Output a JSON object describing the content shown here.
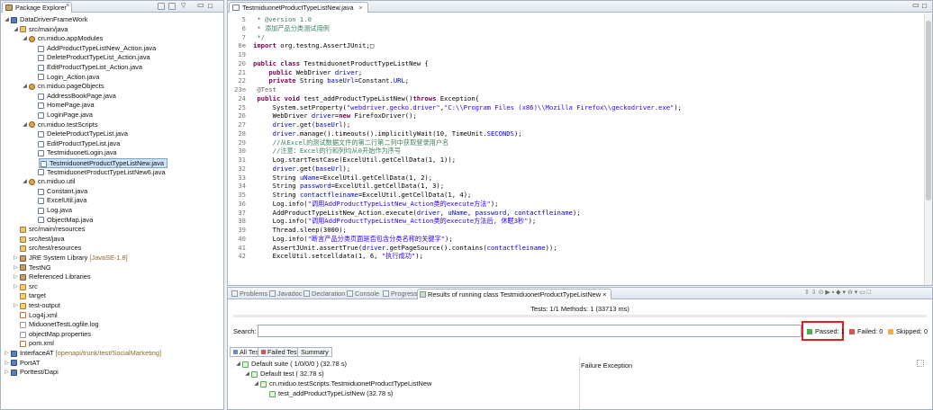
{
  "package_explorer": {
    "title": "Package Explorer",
    "tree": [
      {
        "label": "DataDrivenFrameWork",
        "level": 0,
        "icon": "project-icon",
        "expanded": true
      },
      {
        "label": "src/main/java",
        "level": 1,
        "icon": "source-folder-icon",
        "expanded": true
      },
      {
        "label": "cn.miduo.appModules",
        "level": 2,
        "icon": "package-icon",
        "expanded": true
      },
      {
        "label": "AddProductTypeListNew_Action.java",
        "level": 3,
        "icon": "java-file-icon"
      },
      {
        "label": "DeleteProductTypeList_Action.java",
        "level": 3,
        "icon": "java-file-icon"
      },
      {
        "label": "EditProductTypeList_Action.java",
        "level": 3,
        "icon": "java-file-icon"
      },
      {
        "label": "Login_Action.java",
        "level": 3,
        "icon": "java-file-icon"
      },
      {
        "label": "cn.miduo.pageObjects",
        "level": 2,
        "icon": "package-icon",
        "expanded": true
      },
      {
        "label": "AddressBookPage.java",
        "level": 3,
        "icon": "java-file-icon"
      },
      {
        "label": "HomePage.java",
        "level": 3,
        "icon": "java-file-icon"
      },
      {
        "label": "LoginPage.java",
        "level": 3,
        "icon": "java-file-icon"
      },
      {
        "label": "cn.miduo.testScripts",
        "level": 2,
        "icon": "package-icon",
        "expanded": true
      },
      {
        "label": "DeleteProductTypeList.java",
        "level": 3,
        "icon": "java-file-icon"
      },
      {
        "label": "EditProductTypeList.java",
        "level": 3,
        "icon": "java-file-icon"
      },
      {
        "label": "TestmiduonetLogin.java",
        "level": 3,
        "icon": "java-file-icon"
      },
      {
        "label": "TestmiduonetProductTypeListNew.java",
        "level": 3,
        "icon": "java-file-icon",
        "selected": true
      },
      {
        "label": "TestmiduonetProductTypeListNew6.java",
        "level": 3,
        "icon": "java-file-icon"
      },
      {
        "label": "cn.miduo.util",
        "level": 2,
        "icon": "package-icon",
        "expanded": true
      },
      {
        "label": "Constant.java",
        "level": 3,
        "icon": "java-file-icon"
      },
      {
        "label": "ExcelUtil.java",
        "level": 3,
        "icon": "java-file-icon"
      },
      {
        "label": "Log.java",
        "level": 3,
        "icon": "java-file-icon"
      },
      {
        "label": "ObjectMap.java",
        "level": 3,
        "icon": "java-file-icon"
      },
      {
        "label": "src/main/resources",
        "level": 1,
        "icon": "source-folder-icon"
      },
      {
        "label": "src/test/java",
        "level": 1,
        "icon": "source-folder-icon"
      },
      {
        "label": "src/test/resources",
        "level": 1,
        "icon": "source-folder-icon"
      },
      {
        "label": "JRE System Library",
        "suffix": "[JavaSE-1.8]",
        "level": 1,
        "icon": "library-icon",
        "collapsed": true
      },
      {
        "label": "TestNG",
        "level": 1,
        "icon": "library-icon",
        "collapsed": true
      },
      {
        "label": "Referenced Libraries",
        "level": 1,
        "icon": "library-icon",
        "collapsed": true
      },
      {
        "label": "src",
        "level": 1,
        "icon": "folder-icon",
        "collapsed": true
      },
      {
        "label": "target",
        "level": 1,
        "icon": "folder-icon"
      },
      {
        "label": "test-output",
        "level": 1,
        "icon": "folder-icon",
        "collapsed": true
      },
      {
        "label": "Log4j.xml",
        "level": 1,
        "icon": "xml-file-icon"
      },
      {
        "label": "MiduonetTestLogfile.log",
        "level": 1,
        "icon": "file-icon"
      },
      {
        "label": "objectMap.properties",
        "level": 1,
        "icon": "file-icon"
      },
      {
        "label": "pom.xml",
        "level": 1,
        "icon": "xml-file-icon"
      },
      {
        "label": "InterfaceAT",
        "suffix": "[openapi/trunk/test/SocialMarketing]",
        "level": 0,
        "icon": "project-icon",
        "collapsed": true
      },
      {
        "label": "PortAT",
        "level": 0,
        "icon": "project-icon",
        "collapsed": true
      },
      {
        "label": "Porttest/Dapi",
        "level": 0,
        "icon": "project-icon",
        "collapsed": true
      }
    ]
  },
  "editor": {
    "tab_title": "TestmiduonetProductTypeListNew.java",
    "lines": [
      {
        "n": "5",
        "t": " * @version 1.0",
        "c": "comment"
      },
      {
        "n": "6",
        "t": " * 添加产品分类测试用例",
        "c": "comment"
      },
      {
        "n": "7",
        "t": " */",
        "c": "comment"
      },
      {
        "n": "8⊕",
        "t": "import org.testng.AssertJUnit;□",
        "c": "import"
      },
      {
        "n": "19",
        "t": "",
        "c": "plain"
      },
      {
        "n": "20",
        "t": "public class TestmiduonetProductTypeListNew {",
        "c": "plain"
      },
      {
        "n": "21",
        "t": "    public WebDriver driver;",
        "c": "plain"
      },
      {
        "n": "22",
        "t": "    private String baseUrl=Constant.URL;",
        "c": "plain"
      },
      {
        "n": "23⊖",
        "t": " @Test",
        "c": "annotation"
      },
      {
        "n": "24",
        "t": " public void test_addProductTypeListNew()throws Exception{",
        "c": "plain"
      },
      {
        "n": "25",
        "t": "     System.setProperty(\"webdriver.gecko.driver\",\"C:\\\\Program Files (x86)\\\\Mozilla Firefox\\\\geckodriver.exe\");",
        "c": "plain"
      },
      {
        "n": "26",
        "t": "     WebDriver driver=new FirefoxDriver();",
        "c": "plain"
      },
      {
        "n": "27",
        "t": "     driver.get(baseUrl);",
        "c": "plain"
      },
      {
        "n": "28",
        "t": "     driver.manage().timeouts().implicitlyWait(10, TimeUnit.SECONDS);",
        "c": "plain"
      },
      {
        "n": "29",
        "t": "     //从Excel的测试数据文件的第二行第二列中获取登录用户名",
        "c": "comment"
      },
      {
        "n": "30",
        "t": "     //注意：Excel的行和列均从0开始作为序号",
        "c": "comment"
      },
      {
        "n": "31",
        "t": "     Log.startTestCase(ExcelUtil.getCellData(1, 1));",
        "c": "plain"
      },
      {
        "n": "32",
        "t": "     driver.get(baseUrl);",
        "c": "plain"
      },
      {
        "n": "33",
        "t": "     String uName=ExcelUtil.getCellData(1, 2);",
        "c": "plain"
      },
      {
        "n": "34",
        "t": "     String password=ExcelUtil.getCellData(1, 3);",
        "c": "plain"
      },
      {
        "n": "35",
        "t": "     String contactfleiname=ExcelUtil.getCellData(1, 4);",
        "c": "plain"
      },
      {
        "n": "36",
        "t": "     Log.info(\"调用AddProductTypeListNew_Action类的execute方法\");",
        "c": "plain"
      },
      {
        "n": "37",
        "t": "     AddProductTypeListNew_Action.execute(driver, uName, password, contactfleiname);",
        "c": "plain"
      },
      {
        "n": "38",
        "t": "     Log.info(\"调用AddProductTypeListNew_Action类的execute方法后, 休眠3秒\");",
        "c": "plain"
      },
      {
        "n": "39",
        "t": "     Thread.sleep(3000);",
        "c": "plain"
      },
      {
        "n": "40",
        "t": "     Log.info(\"断言产品分类页面是否包含分类名称的关键字\");",
        "c": "plain"
      },
      {
        "n": "41",
        "t": "     AssertJUnit.assertTrue(driver.getPageSource().contains(contactfleiname));",
        "c": "plain"
      },
      {
        "n": "42",
        "t": "     ExcelUtil.setcelldata(1, 6, \"执行成功\");",
        "c": "plain"
      }
    ]
  },
  "bottom_tabs": [
    "Problems",
    "Javadoc",
    "Declaration",
    "Console",
    "Progress",
    "Results of running class TestmiduonetProductTypeListNew"
  ],
  "results": {
    "summary": "Tests: 1/1  Methods: 1 (33713 ms)",
    "search_label": "Search:",
    "search_value": "",
    "passed": "Passed: 1",
    "failed": "Failed: 0",
    "skipped": "Skipped: 0",
    "subtabs": [
      "All Tests",
      "Failed Tests",
      "Summary"
    ],
    "tree": [
      {
        "label": "Default suite ( 1/0/0/0 ) (32.78 s)",
        "level": 0
      },
      {
        "label": "Default test ( 32.78 s)",
        "level": 1
      },
      {
        "label": "cn.miduo.testScripts.TestmiduonetProductTypeListNew",
        "level": 2
      },
      {
        "label": "test_addProductTypeListNew  (32.78 s)",
        "level": 3
      }
    ],
    "failure_header": "Failure Exception"
  },
  "colors": {
    "passed": "#4caf50",
    "failed": "#d9534f",
    "skipped": "#f0ad4e",
    "highlight_box": "#e02020",
    "comment": "#3f7f5f",
    "keyword": "#7f0055",
    "string": "#2a00ff",
    "field": "#0000c0",
    "annotation": "#646464"
  }
}
